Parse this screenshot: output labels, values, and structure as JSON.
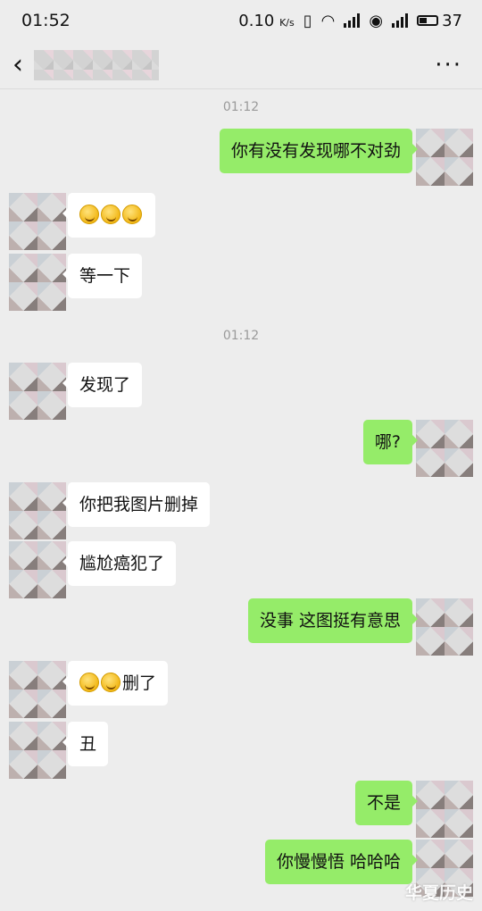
{
  "status_bar": {
    "time": "01:52",
    "net_speed": "0.10",
    "net_unit": "K/s",
    "battery": "37"
  },
  "nav": {
    "title": ""
  },
  "chat": {
    "time_separators": [
      "01:12",
      "01:12"
    ],
    "messages": [
      {
        "side": "right",
        "text": "你有没有发现哪不对劲",
        "emoji_count": 0
      },
      {
        "side": "left",
        "text": "",
        "emoji_count": 3
      },
      {
        "side": "left",
        "text": "等一下",
        "emoji_count": 0
      },
      {
        "side": "left",
        "text": "发现了",
        "emoji_count": 0
      },
      {
        "side": "right",
        "text": "哪?",
        "emoji_count": 0
      },
      {
        "side": "left",
        "text": "你把我图片删掉",
        "emoji_count": 0
      },
      {
        "side": "left",
        "text": "尴尬癌犯了",
        "emoji_count": 0
      },
      {
        "side": "right",
        "text": "没事 这图挺有意思",
        "emoji_count": 0
      },
      {
        "side": "left",
        "text": "删了",
        "emoji_count": 2
      },
      {
        "side": "left",
        "text": "丑",
        "emoji_count": 0
      },
      {
        "side": "right",
        "text": "不是",
        "emoji_count": 0
      },
      {
        "side": "right",
        "text": "你慢慢悟 哈哈哈",
        "emoji_count": 0
      }
    ]
  },
  "watermark": "华夏历史",
  "colors": {
    "background": "#ededed",
    "bubble_sent": "#95ec69",
    "bubble_received": "#ffffff",
    "time_text": "#9a9a9a"
  },
  "icons": {
    "back": "chevron-left-icon",
    "more": "more-dots-icon",
    "emoji": "laughing-tears-emoji-icon"
  }
}
